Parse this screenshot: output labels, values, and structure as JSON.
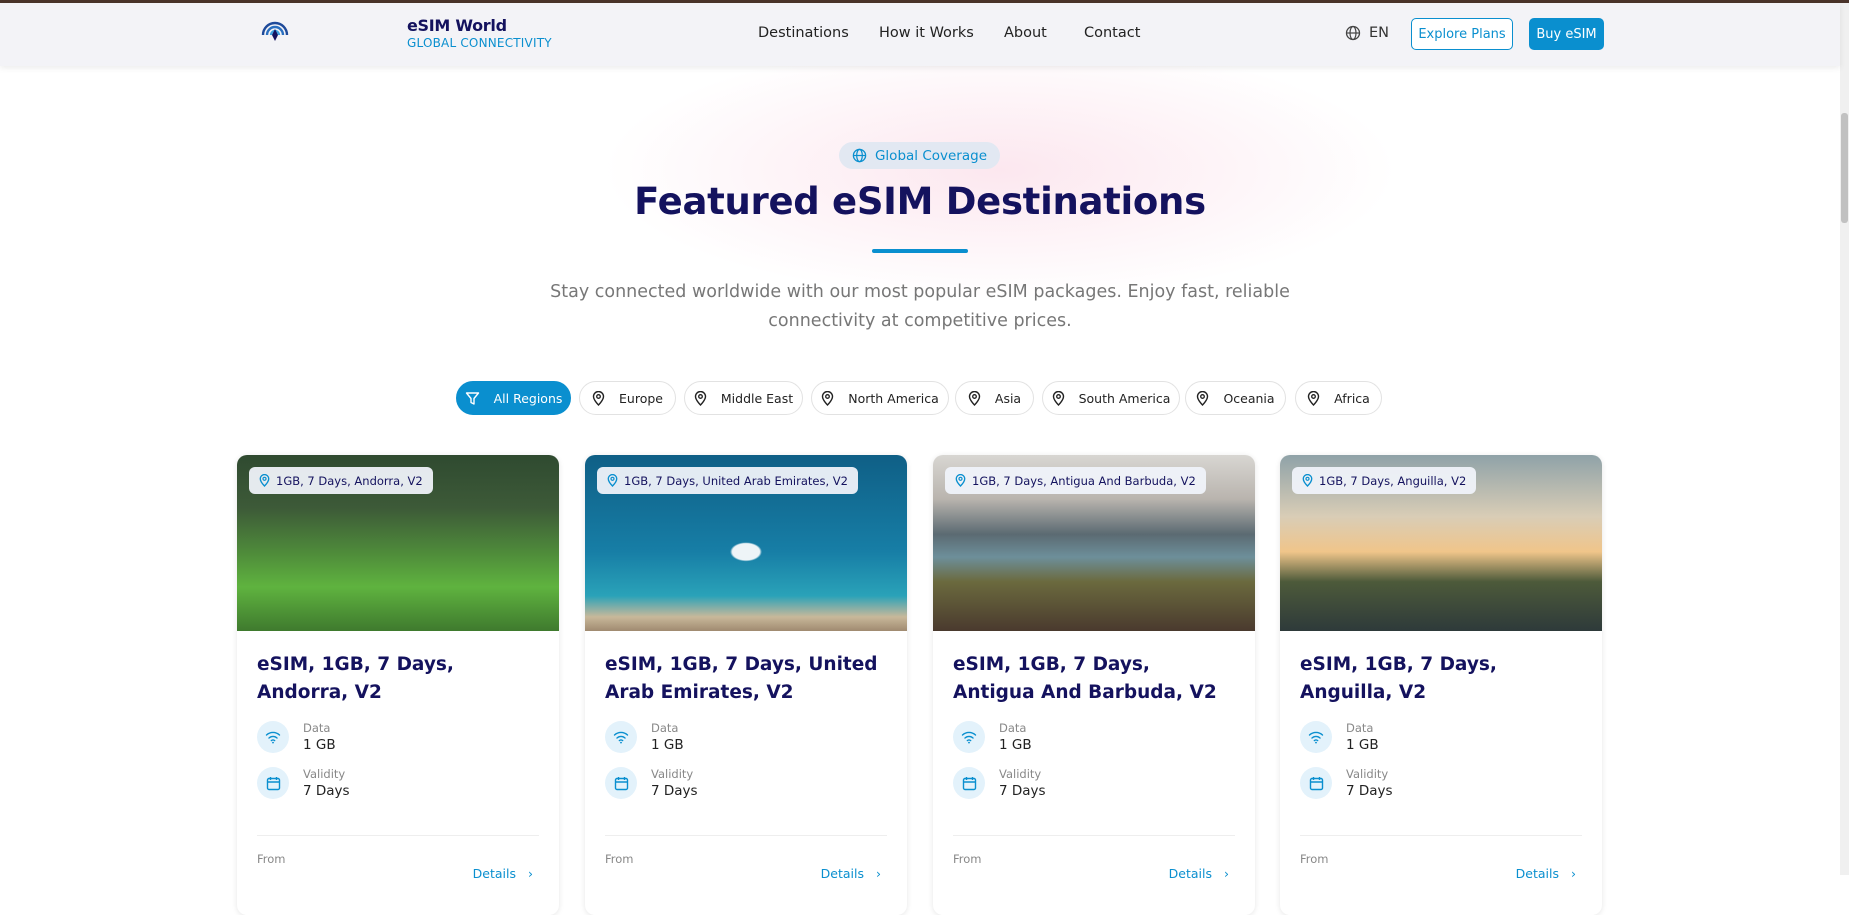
{
  "nav": {
    "brand_title": "eSIM World",
    "brand_subtitle": "GLOBAL CONNECTIVITY",
    "links": [
      "Destinations",
      "How it Works",
      "About",
      "Contact"
    ],
    "language": "EN",
    "explore_label": "Explore Plans",
    "buy_label": "Buy eSIM"
  },
  "hero": {
    "badge": "Global Coverage",
    "title": "Featured eSIM Destinations",
    "subtitle_line1": "Stay connected worldwide with our most popular eSIM packages. Enjoy fast, reliable",
    "subtitle_line2": "connectivity at competitive prices."
  },
  "filters": [
    "All Regions",
    "Europe",
    "Middle East",
    "North America",
    "Asia",
    "South America",
    "Oceania",
    "Africa"
  ],
  "cards": [
    {
      "tag": "1GB, 7 Days, Andorra, V2",
      "title": "eSIM, 1GB, 7 Days, Andorra, V2",
      "data_label": "Data",
      "data": "1 GB",
      "validity_label": "Validity",
      "validity": "7 Days",
      "from": "From",
      "details": "Details"
    },
    {
      "tag": "1GB, 7 Days, United Arab Emirates, V2",
      "title": "eSIM, 1GB, 7 Days, United Arab Emirates, V2",
      "data_label": "Data",
      "data": "1 GB",
      "validity_label": "Validity",
      "validity": "7 Days",
      "from": "From",
      "details": "Details"
    },
    {
      "tag": "1GB, 7 Days, Antigua And Barbuda, V2",
      "title": "eSIM, 1GB, 7 Days, Antigua And Barbuda, V2",
      "data_label": "Data",
      "data": "1 GB",
      "validity_label": "Validity",
      "validity": "7 Days",
      "from": "From",
      "details": "Details"
    },
    {
      "tag": "1GB, 7 Days, Anguilla, V2",
      "title": "eSIM, 1GB, 7 Days, Anguilla, V2",
      "data_label": "Data",
      "data": "1 GB",
      "validity_label": "Validity",
      "validity": "7 Days",
      "from": "From",
      "details": "Details"
    }
  ],
  "colors": {
    "accent": "#0a8fcf",
    "heading": "#14125e"
  }
}
